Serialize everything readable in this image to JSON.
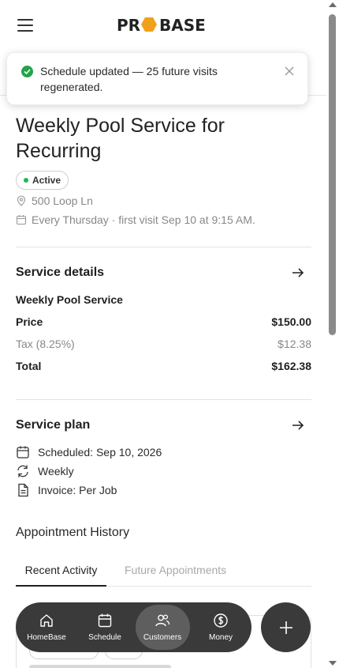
{
  "header": {
    "logo_text": "PROBASE"
  },
  "toast": {
    "message": "Schedule updated — 25 future visits regenerated."
  },
  "job": {
    "title": "Weekly Pool Service for Recurring",
    "status": "Active",
    "address": "500 Loop Ln",
    "schedule_note": "Every Thursday · first visit Sep 10 at 9:15 AM."
  },
  "service_details": {
    "heading": "Service details",
    "service_name": "Weekly Pool Service",
    "price_label": "Price",
    "price_value": "$150.00",
    "tax_label": "Tax (8.25%)",
    "tax_value": "$12.38",
    "total_label": "Total",
    "total_value": "$162.38"
  },
  "service_plan": {
    "heading": "Service plan",
    "scheduled": "Scheduled: Sep 10, 2026",
    "frequency": "Weekly",
    "invoice": "Invoice: Per Job"
  },
  "history": {
    "heading": "Appointment History",
    "tabs": [
      {
        "label": "Recent Activity",
        "active": true
      },
      {
        "label": "Future Appointments",
        "active": false
      }
    ]
  },
  "bottom_nav": {
    "items": [
      {
        "label": "HomeBase",
        "icon": "home-icon"
      },
      {
        "label": "Schedule",
        "icon": "calendar-icon"
      },
      {
        "label": "Customers",
        "icon": "customers-icon",
        "active": true
      },
      {
        "label": "Money",
        "icon": "dollar-icon"
      }
    ]
  },
  "colors": {
    "accent_orange": "#f0a019",
    "success_green": "#22a34a",
    "nav_dark": "#3a3a3a"
  }
}
